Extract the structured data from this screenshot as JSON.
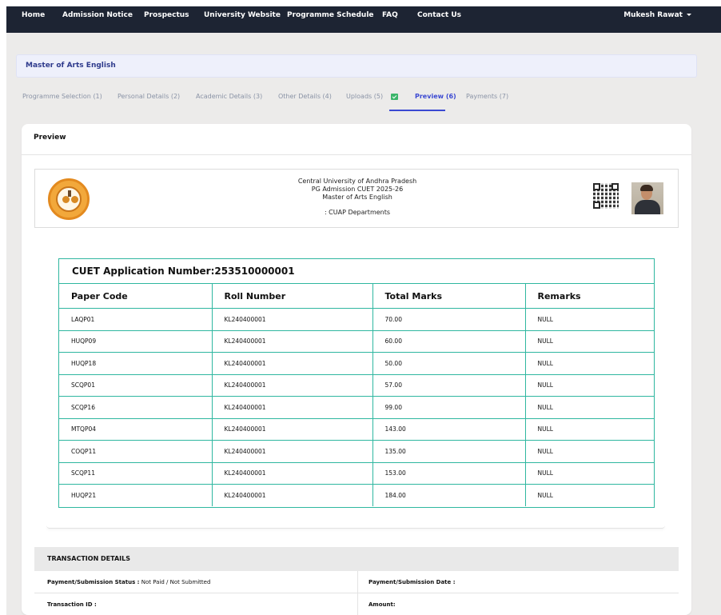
{
  "nav": {
    "items": [
      "Home",
      "Admission Notice",
      "Prospectus",
      "University Website",
      "Programme Schedule",
      "FAQ",
      "Contact Us"
    ],
    "user": "Mukesh Rawat"
  },
  "programme": {
    "name": "Master of Arts English"
  },
  "steps": [
    {
      "label": "Programme Selection",
      "num": "(1)"
    },
    {
      "label": "Personal Details",
      "num": "(2)"
    },
    {
      "label": "Academic Details",
      "num": "(3)"
    },
    {
      "label": "Other Details",
      "num": "(4)"
    },
    {
      "label": "Uploads",
      "num": "(5)"
    },
    {
      "label": "Preview",
      "num": "(6)"
    },
    {
      "label": "Payments",
      "num": "(7)"
    }
  ],
  "card": {
    "title": "Preview"
  },
  "header": {
    "line1": "Central University of Andhra Pradesh",
    "line2": "PG Admission CUET 2025-26",
    "line3": "Master of Arts English",
    "dept": ": CUAP Departments"
  },
  "cuet": {
    "application_label": "CUET Application Number:253510000001",
    "columns": [
      "Paper Code",
      "Roll Number",
      "Total Marks",
      "Remarks"
    ],
    "rows": [
      [
        "LAQP01",
        "KL240400001",
        "70.00",
        "NULL"
      ],
      [
        "HUQP09",
        "KL240400001",
        "60.00",
        "NULL"
      ],
      [
        "HUQP18",
        "KL240400001",
        "50.00",
        "NULL"
      ],
      [
        "SCQP01",
        "KL240400001",
        "57.00",
        "NULL"
      ],
      [
        "SCQP16",
        "KL240400001",
        "99.00",
        "NULL"
      ],
      [
        "MTQP04",
        "KL240400001",
        "143.00",
        "NULL"
      ],
      [
        "COQP11",
        "KL240400001",
        "135.00",
        "NULL"
      ],
      [
        "SCQP11",
        "KL240400001",
        "153.00",
        "NULL"
      ],
      [
        "HUQP21",
        "KL240400001",
        "184.00",
        "NULL"
      ]
    ]
  },
  "transaction": {
    "title": "TRANSACTION DETAILS",
    "status_label": "Payment/Submission Status :",
    "status_value": "Not Paid / Not Submitted",
    "date_label": "Payment/Submission Date :",
    "txn_label": "Transaction ID :",
    "amount_label": "Amount:"
  },
  "colors": {
    "nav_bg": "#1d2433",
    "active_step": "#3b49d2",
    "table_border": "#2fb7a0",
    "check": "#3bb56a"
  }
}
